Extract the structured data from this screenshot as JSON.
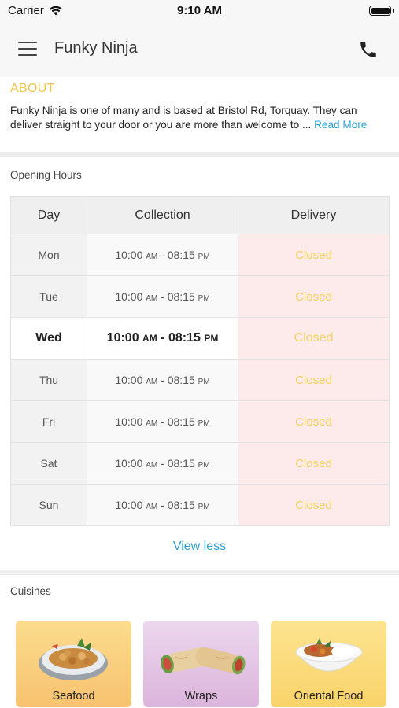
{
  "status_bar": {
    "carrier": "Carrier",
    "time": "9:10 AM"
  },
  "header": {
    "title": "Funky Ninja"
  },
  "about": {
    "title": "ABOUT",
    "text": "Funky Ninja is one of many and is based at Bristol Rd, Torquay. They can deliver straight to your door or you are more than welcome to ... ",
    "read_more": "Read More"
  },
  "opening_hours": {
    "label": "Opening Hours",
    "headers": [
      "Day",
      "Collection",
      "Delivery"
    ],
    "rows": [
      {
        "day": "Mon",
        "open": "10:00",
        "open_ampm": "AM",
        "close": "08:15",
        "close_ampm": "PM",
        "delivery": "Closed"
      },
      {
        "day": "Tue",
        "open": "10:00",
        "open_ampm": "AM",
        "close": "08:15",
        "close_ampm": "PM",
        "delivery": "Closed"
      },
      {
        "day": "Wed",
        "open": "10:00",
        "open_ampm": "AM",
        "close": "08:15",
        "close_ampm": "PM",
        "delivery": "Closed",
        "today": true
      },
      {
        "day": "Thu",
        "open": "10:00",
        "open_ampm": "AM",
        "close": "08:15",
        "close_ampm": "PM",
        "delivery": "Closed"
      },
      {
        "day": "Fri",
        "open": "10:00",
        "open_ampm": "AM",
        "close": "08:15",
        "close_ampm": "PM",
        "delivery": "Closed"
      },
      {
        "day": "Sat",
        "open": "10:00",
        "open_ampm": "AM",
        "close": "08:15",
        "close_ampm": "PM",
        "delivery": "Closed"
      },
      {
        "day": "Sun",
        "open": "10:00",
        "open_ampm": "AM",
        "close": "08:15",
        "close_ampm": "PM",
        "delivery": "Closed"
      }
    ],
    "view_less": "View less"
  },
  "cuisines": {
    "label": "Cuisines",
    "items": [
      {
        "label": "Seafood",
        "icon": "seafood-dish-icon"
      },
      {
        "label": "Wraps",
        "icon": "wraps-icon"
      },
      {
        "label": "Oriental Food",
        "icon": "oriental-food-icon"
      }
    ]
  },
  "colors": {
    "accent_yellow": "#f2c44b",
    "link_blue": "#2fa0d0",
    "delivery_bg": "#fdeaea"
  }
}
